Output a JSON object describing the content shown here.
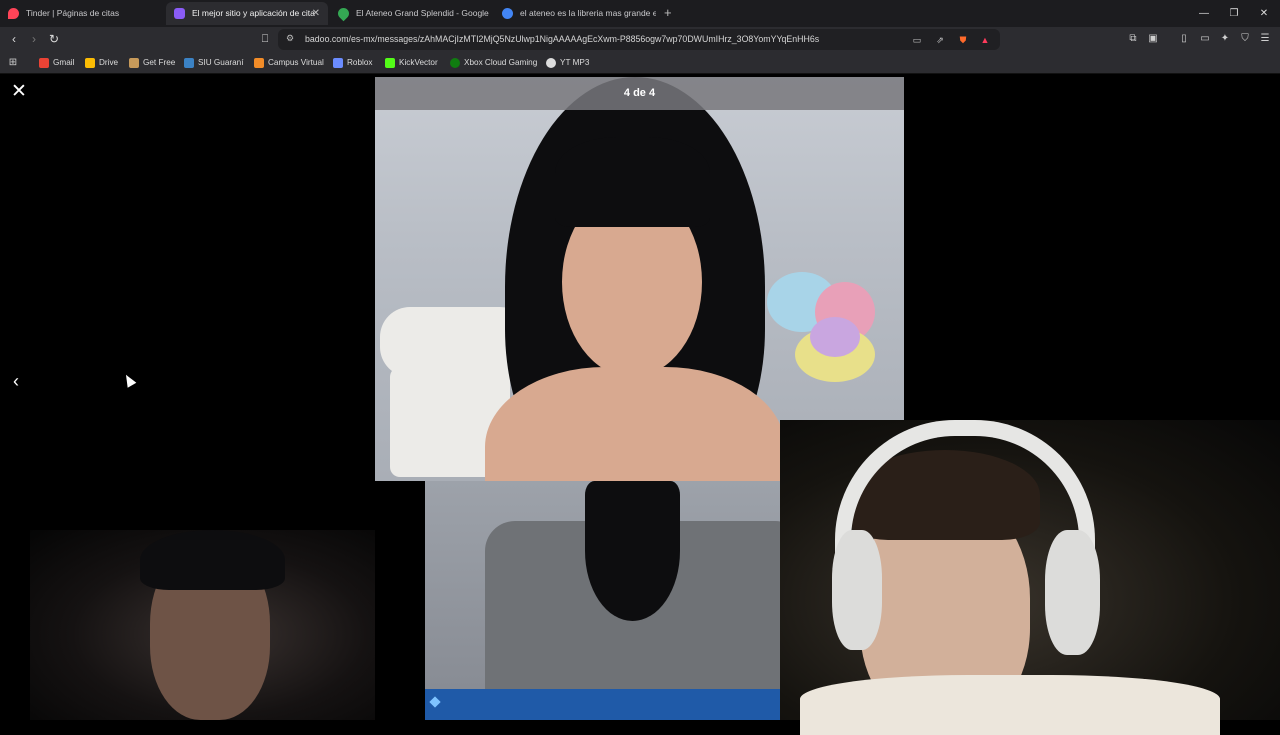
{
  "tabs": [
    {
      "title": "Tinder | Páginas de citas",
      "active": false,
      "icon": "tinder-flame-icon",
      "color": "#ff4458"
    },
    {
      "title": "El mejor sitio y aplicación de cita",
      "active": true,
      "icon": "badoo-icon",
      "color": "#8a5cf6"
    },
    {
      "title": "El Ateneo Grand Splendid - Google M",
      "active": false,
      "icon": "maps-pin-icon",
      "color": "#34a853"
    },
    {
      "title": "el ateneo es la libreria mas grande e",
      "active": false,
      "icon": "google-icon",
      "color": "#4285f4"
    }
  ],
  "address_bar": {
    "url": "badoo.com/es-mx/messages/zAhMACjIzMTI2MjQ5NzUlwp1NigAAAAAgEcXwm-P8856ogw7wp70DWUmIHrz_3O8YomYYqEnHH6s"
  },
  "bookmarks": [
    {
      "label": "Gmail",
      "icon": "gmail-icon",
      "color": "#ea4335"
    },
    {
      "label": "Drive",
      "icon": "drive-icon",
      "color": "#fbbc04"
    },
    {
      "label": "Get Free",
      "icon": "gift-icon",
      "color": "#c79a5a"
    },
    {
      "label": "SIU Guaraní",
      "icon": "siu-icon",
      "color": "#3b82c4"
    },
    {
      "label": "Campus Virtual",
      "icon": "campus-icon",
      "color": "#f28c28"
    },
    {
      "label": "Roblox",
      "icon": "roblox-icon",
      "color": "#6b8cff"
    },
    {
      "label": "KickVector",
      "icon": "kick-icon",
      "color": "#53fc18"
    },
    {
      "label": "Xbox Cloud Gaming",
      "icon": "xbox-icon",
      "color": "#107c10"
    },
    {
      "label": "YT MP3",
      "icon": "ytmp3-icon",
      "color": "#dddddd"
    }
  ],
  "viewer": {
    "counter": "4 de 4"
  },
  "colors": {
    "accent_blue": "#1f5aa8",
    "chrome_dark": "#2c2c30"
  }
}
